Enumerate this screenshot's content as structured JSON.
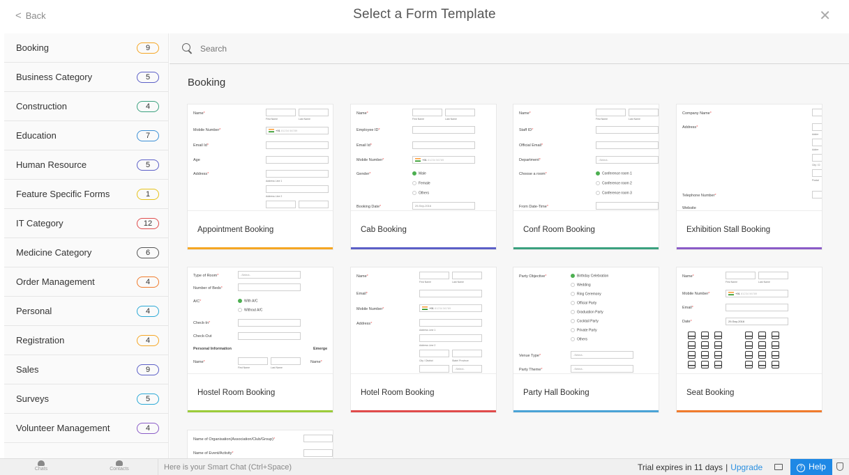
{
  "header": {
    "back_label": "Back",
    "title": "Select a Form Template",
    "close_glyph": "✕"
  },
  "search": {
    "placeholder": "Search"
  },
  "sidebar": {
    "items": [
      {
        "label": "Booking",
        "count": "9",
        "color": "#f5a623"
      },
      {
        "label": "Business Category",
        "count": "5",
        "color": "#5b5fc7"
      },
      {
        "label": "Construction",
        "count": "4",
        "color": "#3aa17e"
      },
      {
        "label": "Education",
        "count": "7",
        "color": "#3b8fd6"
      },
      {
        "label": "Human Resource",
        "count": "5",
        "color": "#5b5fc7"
      },
      {
        "label": "Feature Specific Forms",
        "count": "1",
        "color": "#e6c21a"
      },
      {
        "label": "IT Category",
        "count": "12",
        "color": "#e04b4b"
      },
      {
        "label": "Medicine Category",
        "count": "6",
        "color": "#555555"
      },
      {
        "label": "Order Management",
        "count": "4",
        "color": "#f07b2c"
      },
      {
        "label": "Personal",
        "count": "4",
        "color": "#2aa8d6"
      },
      {
        "label": "Registration",
        "count": "4",
        "color": "#f5a623"
      },
      {
        "label": "Sales",
        "count": "9",
        "color": "#5b5fc7"
      },
      {
        "label": "Surveys",
        "count": "5",
        "color": "#2aa8d6"
      },
      {
        "label": "Volunteer Management",
        "count": "4",
        "color": "#8a5bc7"
      }
    ]
  },
  "section": {
    "title": "Booking"
  },
  "cards": [
    {
      "name": "Appointment Booking",
      "accent": "#f5a623"
    },
    {
      "name": "Cab Booking",
      "accent": "#5b5fc7"
    },
    {
      "name": "Conf Room Booking",
      "accent": "#3aa17e"
    },
    {
      "name": "Exhibition Stall Booking",
      "accent": "#8a5bc7"
    },
    {
      "name": "Hostel Room Booking",
      "accent": "#9ccc3a"
    },
    {
      "name": "Hotel Room Booking",
      "accent": "#e04b4b"
    },
    {
      "name": "Party Hall Booking",
      "accent": "#4aa3d6"
    },
    {
      "name": "Seat Booking",
      "accent": "#f07b2c"
    }
  ],
  "previews": {
    "appointment": {
      "name": "Name",
      "first": "First Name",
      "last": "Last Name",
      "mobile": "Mobile Number",
      "phone_code": "+91",
      "phone_ph": "81234 56789",
      "email": "Email Id",
      "age": "Age",
      "address": "Address",
      "addr1": "Address Line 1",
      "addr2": "Address Line 2"
    },
    "cab": {
      "name": "Name",
      "first": "First Name",
      "last": "Last Name",
      "emp": "Employee ID",
      "email": "Email Id",
      "mobile": "Mobile Number",
      "phone_code": "+91",
      "phone_ph": "81234 56789",
      "gender": "Gender",
      "male": "Male",
      "female": "Female",
      "others": "Others",
      "date": "Booking Date",
      "date_val": "29-Sep-2016"
    },
    "conf": {
      "name": "Name",
      "first": "First Name",
      "last": "Last Name",
      "staff": "Staff ID",
      "email": "Official Email",
      "dept": "Department",
      "select": "-Select-",
      "room": "Choose a room",
      "r1": "Conference room 1",
      "r2": "Conference room 2",
      "r3": "Conference room 3",
      "from": "From Date-Time"
    },
    "exhibition": {
      "company": "Company Name",
      "address": "Address",
      "addr_a": "Addre",
      "addr_b": "Addre",
      "city": "City / D",
      "postal": "Postal",
      "tel": "Telephone Number",
      "web": "Website"
    },
    "hostel": {
      "type": "Type of Room",
      "select": "-Select-",
      "beds": "Number of Beds",
      "ac": "A/C",
      "with": "With A/C",
      "without": "Without A/C",
      "in": "Check-In",
      "out": "Check-Out",
      "personal": "Personal Information",
      "emerg": "Emerge",
      "name": "Name",
      "name2": "Name",
      "first": "First Name",
      "last": "Last Name"
    },
    "hotel": {
      "name": "Name",
      "first": "First Name",
      "last": "Last Name",
      "email": "Email",
      "mobile": "Mobile Number",
      "phone_code": "+91",
      "phone_ph": "81234 56789",
      "address": "Address",
      "addr1": "Address Line 1",
      "addr2": "Address Line 2",
      "city": "City / District",
      "state": "State/ Province",
      "select": "-Select-"
    },
    "party": {
      "objective": "Party Objective",
      "o1": "Birthday Celebration",
      "o2": "Wedding",
      "o3": "Ring Ceremony",
      "o4": "Official Party",
      "o5": "Graduation Party",
      "o6": "Cocktail Party",
      "o7": "Private Party",
      "o8": "Others",
      "venue": "Venue Type",
      "theme": "Party Theme",
      "select": "-Select-"
    },
    "seat": {
      "name": "Name",
      "first": "First Name",
      "last": "Last Name",
      "mobile": "Mobile Number",
      "phone_code": "+91",
      "phone_ph": "81234 56789",
      "email": "Email",
      "date": "Date",
      "date_val": "29-Sep-2016"
    },
    "volunteer": {
      "org": "Name of Organisation(Association/Club/Group)",
      "event": "Name of Event/Activity"
    }
  },
  "bottombar": {
    "chats": "Chats",
    "contacts": "Contacts",
    "smart_chat": "Here is your Smart Chat (Ctrl+Space)",
    "trial": "Trial expires in 11 days",
    "sep": "|",
    "upgrade": "Upgrade",
    "help": "Help",
    "help_q": "?"
  }
}
